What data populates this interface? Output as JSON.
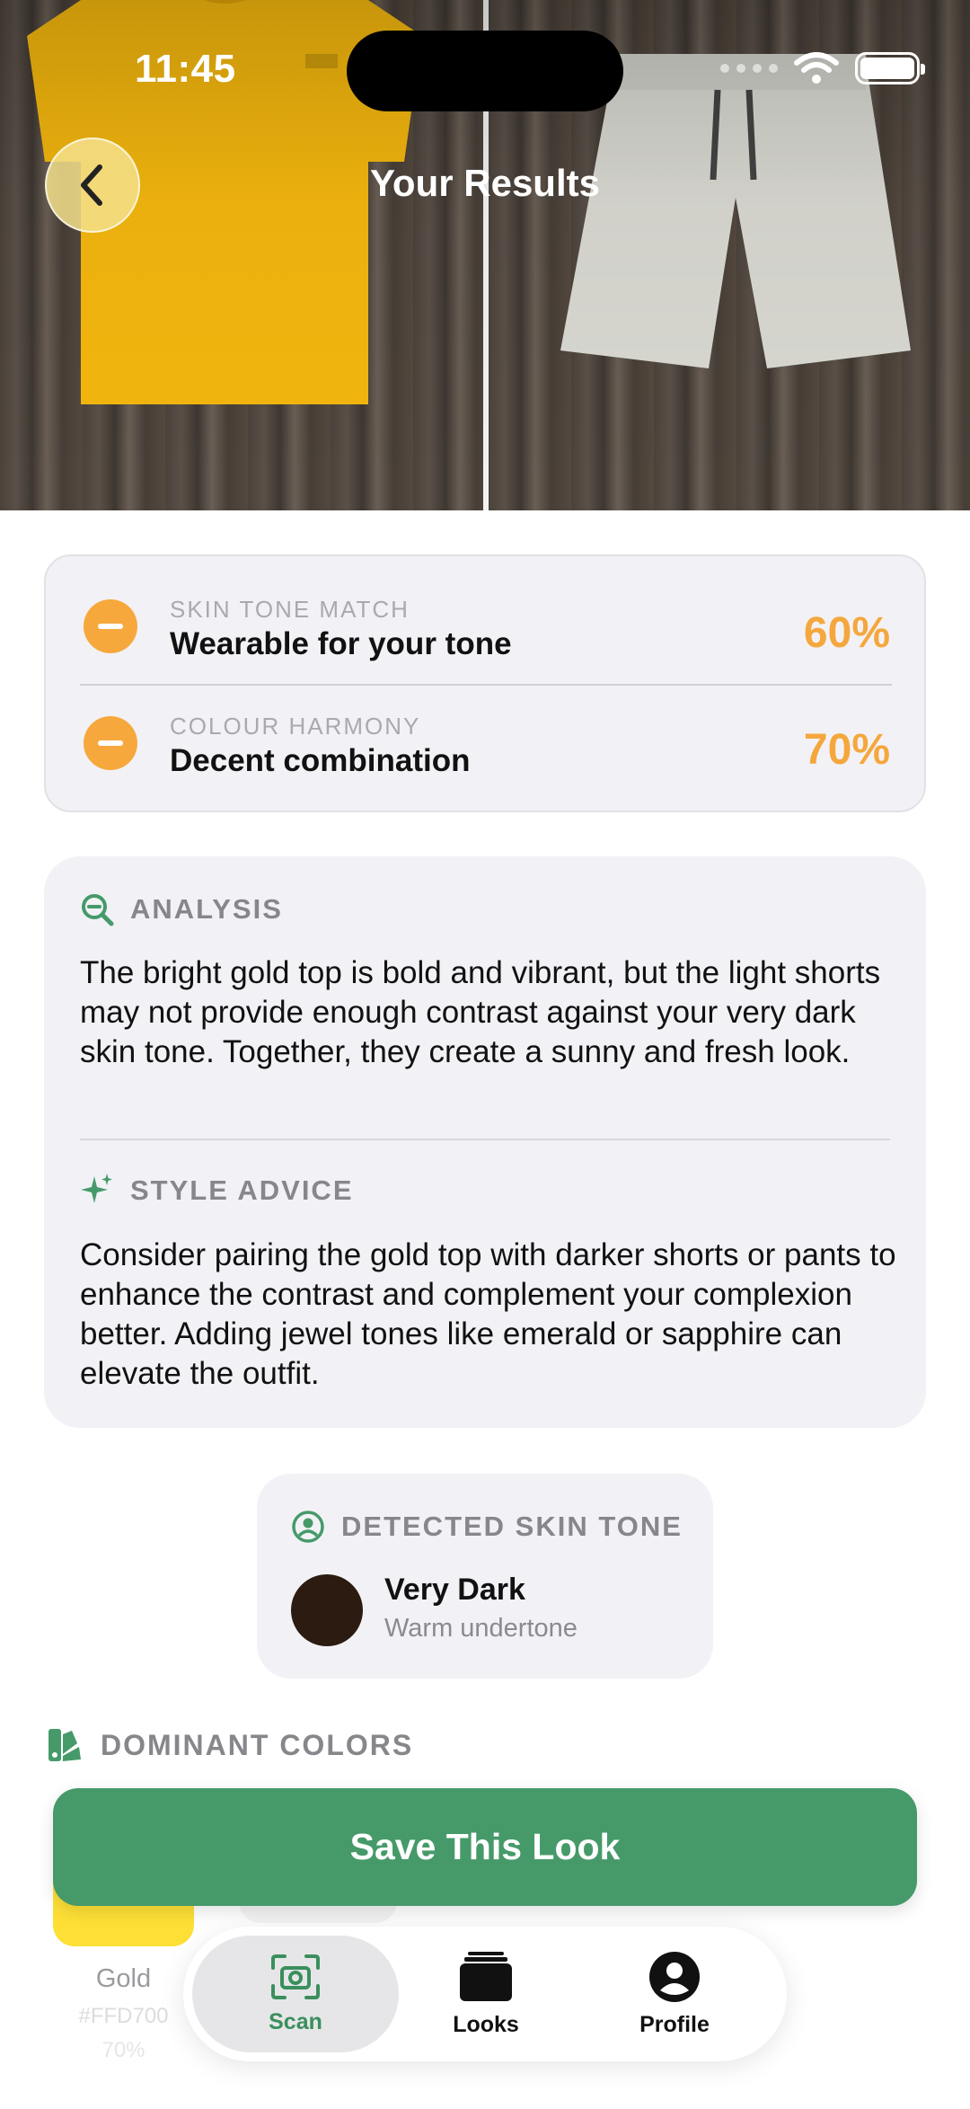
{
  "status_bar": {
    "time": "11:45"
  },
  "header": {
    "title": "Your Results"
  },
  "scores": [
    {
      "kicker": "SKIN TONE MATCH",
      "label": "Wearable for your tone",
      "percent": "60%"
    },
    {
      "kicker": "COLOUR HARMONY",
      "label": "Decent combination",
      "percent": "70%"
    }
  ],
  "analysis": {
    "heading": "ANALYSIS",
    "body": "The bright gold top is bold and vibrant, but the light shorts may not provide enough contrast against your very dark skin tone. Together, they create a sunny and fresh look."
  },
  "style_advice": {
    "heading": "STYLE ADVICE",
    "body": "Consider pairing the gold top with darker shorts or pants to enhance the contrast and complement your complexion better. Adding jewel tones like emerald or sapphire can elevate the outfit."
  },
  "skin_tone": {
    "heading": "DETECTED SKIN TONE",
    "name": "Very Dark",
    "undertone": "Warm undertone",
    "swatch_color": "#2b1b10"
  },
  "dominant_colors": {
    "heading": "DOMINANT COLORS",
    "items": [
      {
        "name": "Gold",
        "hex": "#FFD700",
        "percent": "70%"
      }
    ]
  },
  "save_button": {
    "label": "Save This Look"
  },
  "tabbar": {
    "tabs": [
      {
        "label": "Scan",
        "icon": "camera-scan-icon",
        "active": true
      },
      {
        "label": "Looks",
        "icon": "stack-icon",
        "active": false
      },
      {
        "label": "Profile",
        "icon": "person-circle-icon",
        "active": false
      }
    ]
  },
  "colors": {
    "accent_green": "#469a6a",
    "score_orange": "#f5a73d"
  }
}
